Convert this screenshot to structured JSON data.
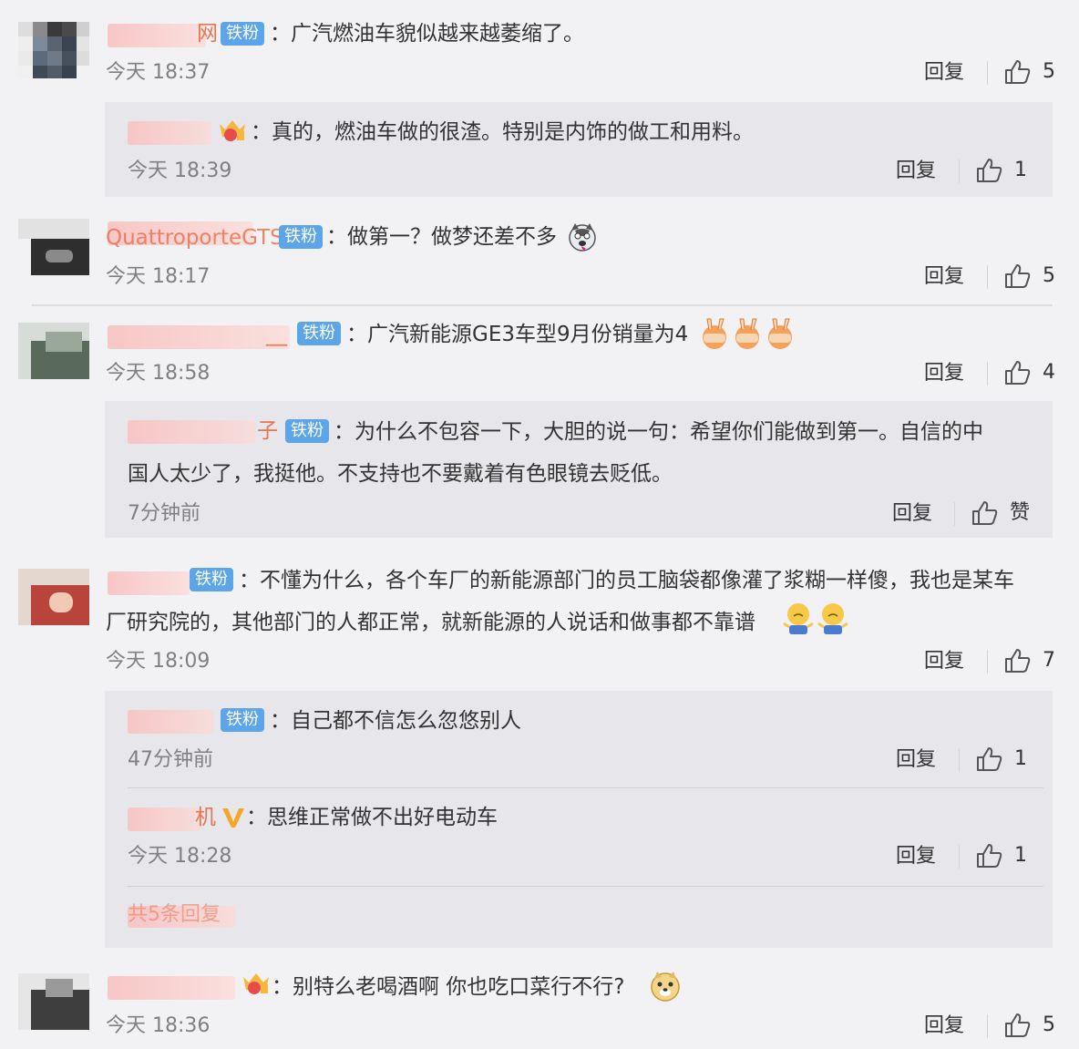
{
  "comments": [
    {
      "id": "c1",
      "name_visible_tail": "网",
      "badge": "铁粉",
      "text": "：广汽燃油车貌似越来越萎缩了。",
      "time": "今天 18:37",
      "reply_label": "回复",
      "likes": "5",
      "replies": [
        {
          "name_visible_tail": "",
          "text": "：真的，燃油车做的很渣。特别是内饰的做工和用料。",
          "time": "今天 18:39",
          "reply_label": "回复",
          "likes": "1"
        }
      ]
    },
    {
      "id": "c2",
      "name_visible_tail": "QuattroporteGTS",
      "badge": "铁粉",
      "text": "：做第一？做梦还差不多",
      "time": "今天 18:17",
      "reply_label": "回复",
      "likes": "5"
    },
    {
      "id": "c3",
      "name_visible_tail": "__",
      "badge": "铁粉",
      "text": "：广汽新能源GE3车型9月份销量为4",
      "time": "今天 18:58",
      "reply_label": "回复",
      "likes": "4",
      "replies": [
        {
          "name_visible_tail": "子",
          "badge": "铁粉",
          "text_line1": "：为什么不包容一下，大胆的说一句：希望你们能做到第一。自信的中",
          "text_line2": "国人太少了，我挺他。不支持也不要戴着有色眼镜去贬低。",
          "time": "7分钟前",
          "reply_label": "回复",
          "likes": "赞"
        }
      ]
    },
    {
      "id": "c4",
      "badge": "铁粉",
      "text_line1": "：不懂为什么，各个车厂的新能源部门的员工脑袋都像灌了浆糊一样傻，我也是某车",
      "text_line2": "厂研究院的，其他部门的人都正常，就新能源的人说话和做事都不靠谱",
      "time": "今天 18:09",
      "reply_label": "回复",
      "likes": "7",
      "replies": [
        {
          "name_visible_tail": "",
          "badge": "铁粉",
          "text": "：自己都不信怎么忽悠别人",
          "time": "47分钟前",
          "reply_label": "回复",
          "likes": "1"
        },
        {
          "name_visible_tail": "机",
          "text": "：思维正常做不出好电动车",
          "time": "今天 18:28",
          "reply_label": "回复",
          "likes": "1"
        }
      ],
      "more_replies": "共5条回复"
    },
    {
      "id": "c5",
      "name_visible_tail": "",
      "text": "：别特么老喝酒啊 你也吃口菜行不行?",
      "time": "今天 18:36",
      "reply_label": "回复",
      "likes": "5"
    }
  ],
  "icons": {
    "like": "thumbs-up-icon",
    "vip": "crown-icon",
    "verified": "v-icon"
  },
  "colors": {
    "background": "#f2f2f5",
    "sub_panel": "#e6e6eb",
    "badge": "#5ba5e8",
    "name": "#eb7350",
    "verified": "#f5a623"
  }
}
